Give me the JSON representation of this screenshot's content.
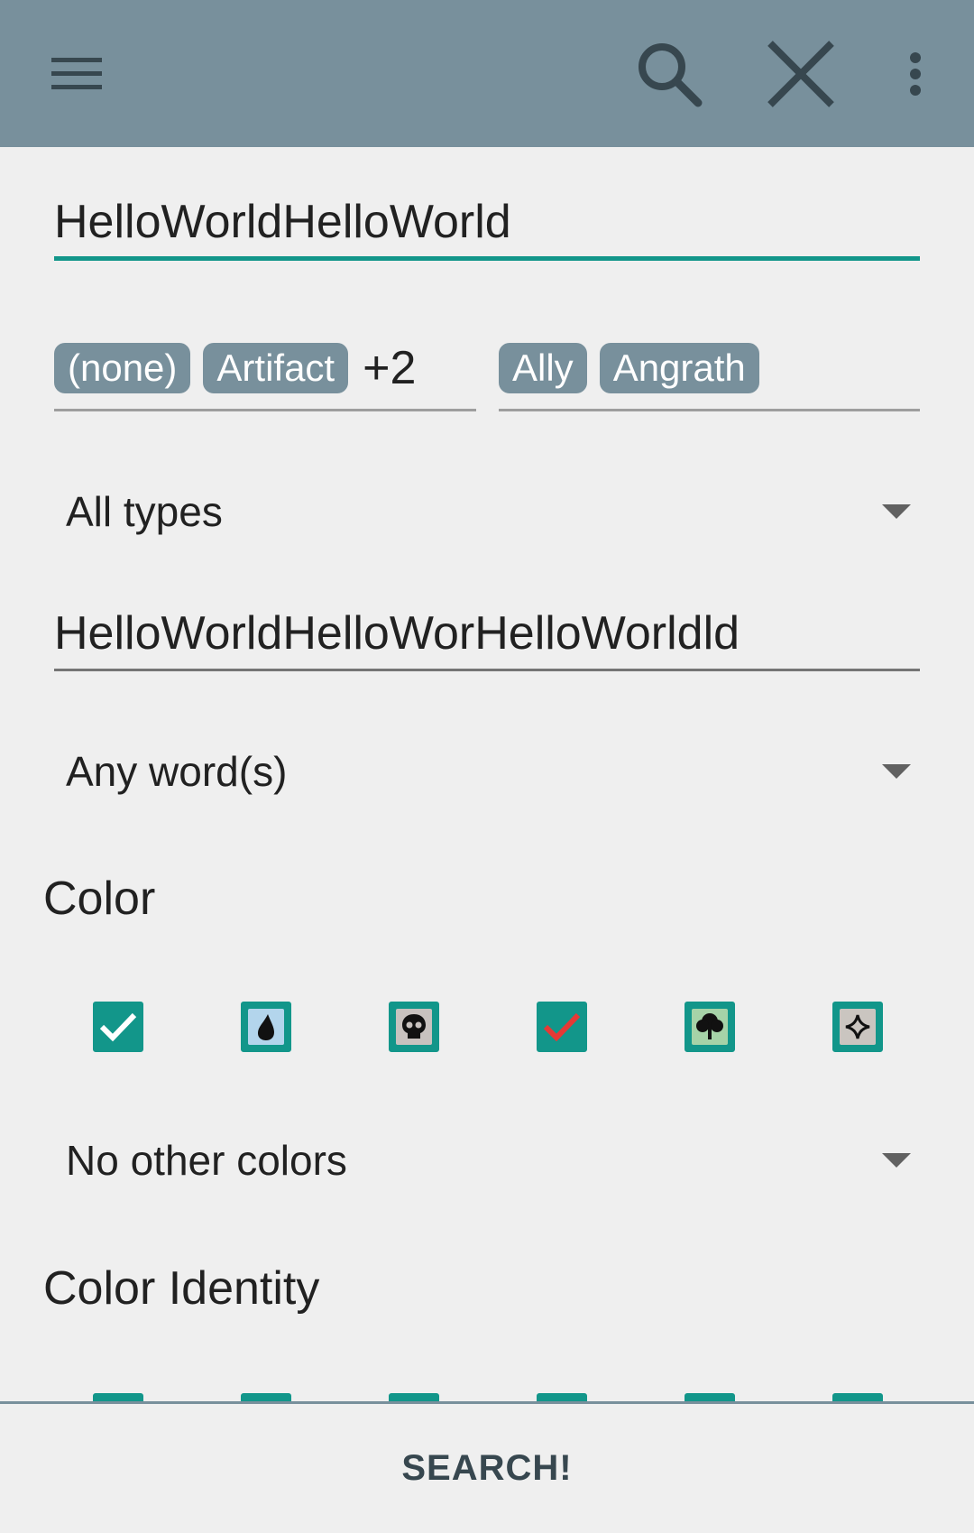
{
  "appbar": {
    "icons": [
      "menu-icon",
      "search-icon",
      "close-icon",
      "more-vert-icon"
    ],
    "background": "#78909c"
  },
  "form": {
    "name_field": {
      "value": "HelloWorldHelloWorld"
    },
    "supertypes": {
      "chips": [
        "(none)",
        "Artifact"
      ],
      "more": "+2"
    },
    "subtypes": {
      "chips": [
        "Ally",
        "Angrath"
      ]
    },
    "type_mode": {
      "selected": "All types"
    },
    "text_field": {
      "value": "HelloWorldHelloWorHelloWorldld"
    },
    "text_mode": {
      "selected": "Any word(s)"
    },
    "color_section": {
      "title": "Color",
      "checkboxes": [
        {
          "name": "white",
          "checked": true
        },
        {
          "name": "blue",
          "checked": false
        },
        {
          "name": "black",
          "checked": false
        },
        {
          "name": "red",
          "checked": true
        },
        {
          "name": "green",
          "checked": false
        },
        {
          "name": "colorless",
          "checked": false
        }
      ],
      "mode": "No other colors"
    },
    "identity_section": {
      "title": "Color Identity"
    }
  },
  "bottom": {
    "search_label": "SEARCH!"
  },
  "colors": {
    "accent": "#12968a",
    "chip": "#78909c",
    "red_check": "#e53935"
  }
}
